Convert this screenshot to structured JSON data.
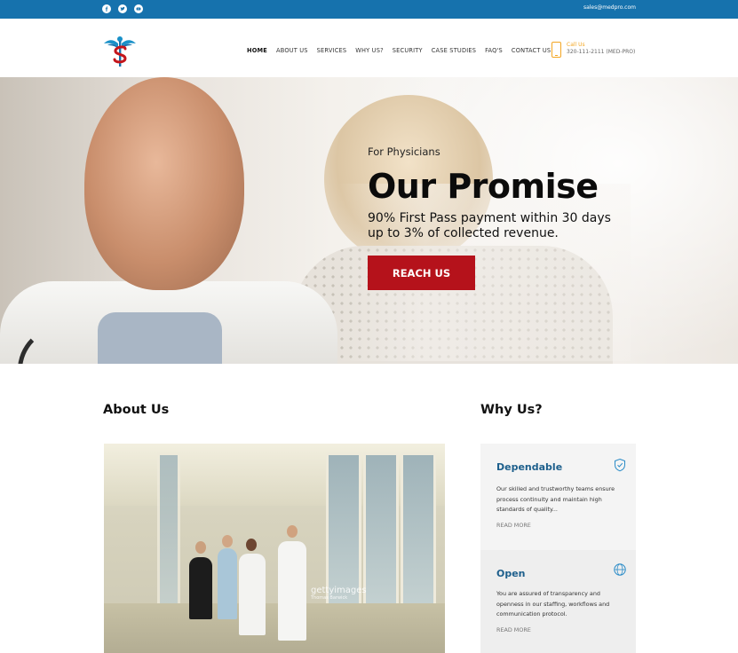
{
  "topbar": {
    "email": "sales@medpro.com",
    "social": [
      "facebook-icon",
      "twitter-icon",
      "youtube-icon"
    ],
    "background": "#1672ad"
  },
  "header": {
    "nav": [
      "HOME",
      "ABOUT US",
      "SERVICES",
      "WHY US?",
      "SECURITY",
      "CASE STUDIES",
      "FAQ'S",
      "CONTACT US"
    ],
    "active_nav": "HOME",
    "call_label": "Call Us",
    "call_number": "320-111-2111 (MED-PRO)"
  },
  "hero": {
    "subtitle": "For Physicians",
    "title": "Our Promise",
    "line1": "90% First Pass payment within 30 days",
    "line2": "up to 3% of collected revenue.",
    "button": "REACH US",
    "button_color": "#b5121b"
  },
  "about": {
    "title": "About Us",
    "watermark": "gettyimages",
    "watermark_credit": "Thomas Barwick"
  },
  "why": {
    "title": "Why Us?",
    "cards": [
      {
        "title": "Dependable",
        "text": "Our skilled and trustworthy teams ensure process continuity and maintain high standards of quality...",
        "more": "READ MORE",
        "icon": "shield-icon"
      },
      {
        "title": "Open",
        "text": "You are assured of transparency and openness in our staffing, workflows and communication protocol.",
        "more": "READ MORE",
        "icon": "globe-icon"
      }
    ]
  },
  "colors": {
    "accent_blue": "#1d5f8c",
    "phone_orange": "#f3a623"
  }
}
